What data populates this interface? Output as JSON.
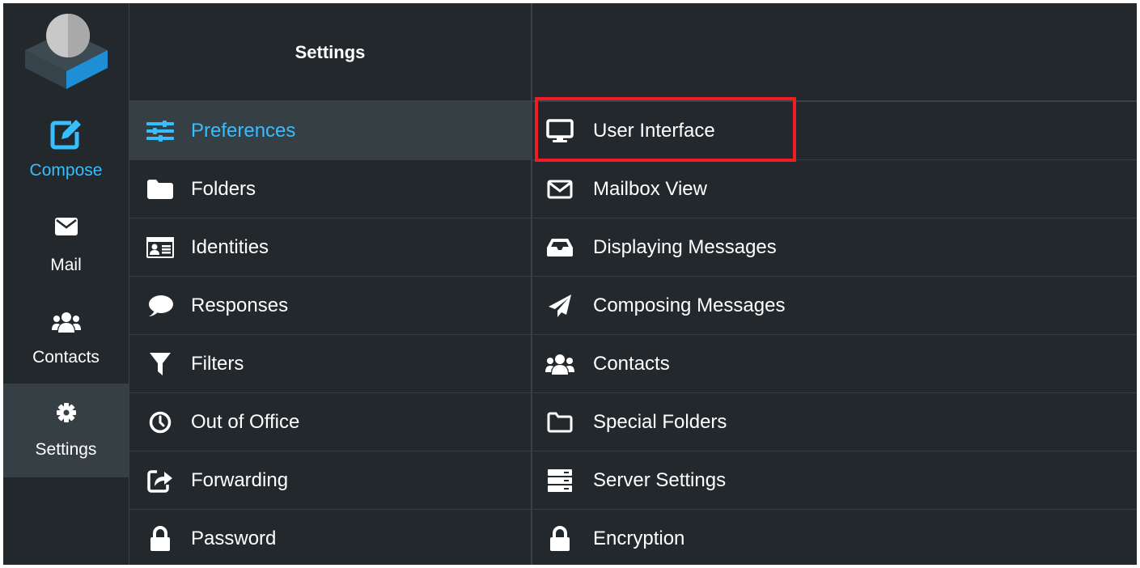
{
  "colors": {
    "background": "#22282c",
    "accent": "#37beff",
    "selected_row": "#363f44",
    "highlight_box": "#ee1c24",
    "text": "#ffffff"
  },
  "nav": {
    "logo": "roundcube-logo",
    "items": [
      {
        "label": "Compose",
        "icon": "compose-icon",
        "active_color": true
      },
      {
        "label": "Mail",
        "icon": "envelope-icon"
      },
      {
        "label": "Contacts",
        "icon": "users-icon"
      },
      {
        "label": "Settings",
        "icon": "gear-icon",
        "selected": true
      }
    ]
  },
  "settings": {
    "title": "Settings",
    "items": [
      {
        "label": "Preferences",
        "icon": "sliders-icon",
        "selected": true
      },
      {
        "label": "Folders",
        "icon": "folder-icon"
      },
      {
        "label": "Identities",
        "icon": "id-card-icon"
      },
      {
        "label": "Responses",
        "icon": "comment-icon"
      },
      {
        "label": "Filters",
        "icon": "filter-icon"
      },
      {
        "label": "Out of Office",
        "icon": "clock-icon"
      },
      {
        "label": "Forwarding",
        "icon": "share-icon"
      },
      {
        "label": "Password",
        "icon": "lock-icon"
      }
    ]
  },
  "preferences": {
    "items": [
      {
        "label": "User Interface",
        "icon": "desktop-icon",
        "highlighted": true
      },
      {
        "label": "Mailbox View",
        "icon": "envelope-outline-icon"
      },
      {
        "label": "Displaying Messages",
        "icon": "inbox-icon"
      },
      {
        "label": "Composing Messages",
        "icon": "paper-plane-icon"
      },
      {
        "label": "Contacts",
        "icon": "users-icon"
      },
      {
        "label": "Special Folders",
        "icon": "folder-outline-icon"
      },
      {
        "label": "Server Settings",
        "icon": "server-icon"
      },
      {
        "label": "Encryption",
        "icon": "lock-icon"
      }
    ]
  }
}
